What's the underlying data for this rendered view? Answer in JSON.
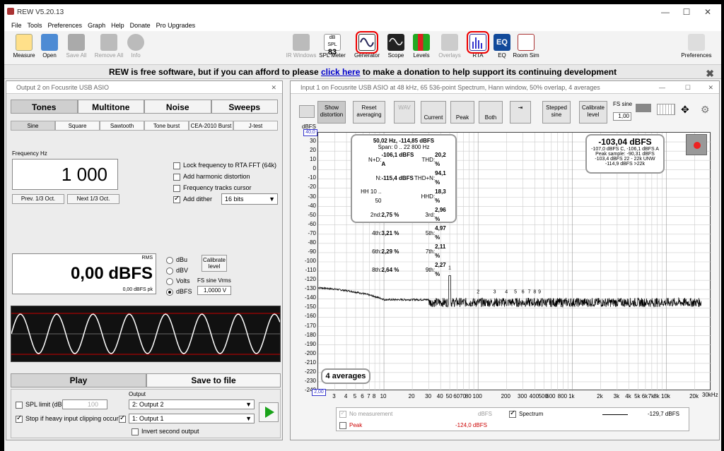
{
  "app": {
    "title": "REW V5.20.13"
  },
  "menu": [
    "File",
    "Tools",
    "Preferences",
    "Graph",
    "Help",
    "Donate",
    "Pro Upgrades"
  ],
  "toolbar": {
    "measure": "Measure",
    "open": "Open",
    "save_all": "Save All",
    "remove_all": "Remove All",
    "info": "Info",
    "ir_windows": "IR Windows",
    "spl_meter": "SPL Meter",
    "spl_badge": "dB SPL",
    "spl_value": "83",
    "generator": "Generator",
    "scope": "Scope",
    "levels": "Levels",
    "overlays": "Overlays",
    "rta": "RTA",
    "eq": "EQ",
    "room_sim": "Room Sim",
    "preferences": "Preferences"
  },
  "banner": {
    "text_before": "REW is free software, but if you can afford to please",
    "link": "click here",
    "text_after": "to make a donation to help support its continuing development",
    "close": "✖"
  },
  "generator": {
    "title": "Output 2 on Focusrite USB ASIO",
    "tabs": [
      "Tones",
      "Multitone",
      "Noise",
      "Sweeps"
    ],
    "subtabs": [
      "Sine",
      "Square",
      "Sawtooth",
      "Tone burst",
      "CEA-2010 Burst",
      "J-test"
    ],
    "freq_label": "Frequency Hz",
    "freq_value": "1 000",
    "prev": "Prev. 1/3 Oct.",
    "next": "Next 1/3 Oct.",
    "opt_lock": "Lock frequency to RTA FFT (64k)",
    "opt_harm": "Add harmonic distortion",
    "opt_cursor": "Frequency tracks cursor",
    "opt_dither": "Add dither",
    "dither_value": "16 bits",
    "rms_label": "RMS",
    "level_value": "0,00 dBFS",
    "level_pk": "0,00 dBFS pk",
    "units": [
      "dBu",
      "dBV",
      "Volts",
      "dBFS"
    ],
    "calibrate": "Calibrate level",
    "fs_sine": "FS sine Vrms",
    "fs_value": "1,0000 V",
    "play": "Play",
    "save": "Save to file",
    "spl_limit": "SPL limit (dB):",
    "spl_limit_val": "100",
    "stop_clip": "Stop if heavy input clipping occurs",
    "output_label": "Output",
    "output1": "2: Output 2",
    "output2": "1: Output 1",
    "invert": "Invert second output"
  },
  "rta": {
    "title": "Input 1 on Focusrite USB ASIO at 48 kHz, 65 536-point Spectrum, Hann window, 50% overlap, 4 averages",
    "buttons": {
      "show": "Show distortion",
      "reset": "Reset averaging",
      "wav": "WAV",
      "current": "Current",
      "peak": "Peak",
      "both": "Both",
      "stepped": "Stepped sine",
      "calibrate": "Calibrate level",
      "fs_sine": "FS sine",
      "fs_val": "1,00"
    },
    "ylabel": "dBFS",
    "ymax_label": "40,0",
    "xmin_label": "2,00",
    "xunit": "30kHz",
    "yticks": [
      "30",
      "20",
      "10",
      "0",
      "-10",
      "-20",
      "-30",
      "-40",
      "-50",
      "-60",
      "-70",
      "-80",
      "-90",
      "-100",
      "-110",
      "-120",
      "-130",
      "-140",
      "-150",
      "-160",
      "-170",
      "-180",
      "-190",
      "-200",
      "-210",
      "-220",
      "-230",
      "-240"
    ],
    "xticks": [
      "3",
      "4",
      "5",
      "6",
      "7",
      "8",
      "10",
      "20",
      "30",
      "40",
      "50",
      "60",
      "70",
      "80",
      "100",
      "200",
      "300",
      "400",
      "500",
      "600",
      "800",
      "1k",
      "2k",
      "3k",
      "4k",
      "5k",
      "6k",
      "7k",
      "8k",
      "10k",
      "20k"
    ],
    "harm_labels": [
      "1",
      "2",
      "3",
      "4",
      "5",
      "6",
      "7",
      "8",
      "9"
    ],
    "dist": {
      "fund": "50,02 Hz, -114,85 dBFS",
      "span": "Span: 0 .. 22 800 Hz",
      "rows": [
        [
          "N+D:",
          "-106,1 dBFS A",
          "THD:",
          "20,2 %"
        ],
        [
          "N:",
          "-115,4 dBFS",
          "THD+N:",
          "94,1 %"
        ],
        [
          "HH 10 .. 50",
          "",
          "HHD:",
          "18,3 %"
        ],
        [
          "2nd:",
          "2,75 %",
          "3rd:",
          "2,96 %"
        ],
        [
          "4th:",
          "3,21 %",
          "5th:",
          "4,97 %"
        ],
        [
          "6th:",
          "2,29 %",
          "7th:",
          "2,11 %"
        ],
        [
          "8th:",
          "2,64 %",
          "9th:",
          "2,27 %"
        ]
      ]
    },
    "level": {
      "main": "-103,04 dBFS",
      "l1": "-107,0 dBFS C, -106,1 dBFS A",
      "l2": "Peak sample: -90,31 dBFS",
      "l3": "-103,4 dBFS 22 - 22k UNW",
      "l4": "-114,9 dBFS >22k"
    },
    "averages": "4 averages",
    "legend": {
      "nomeas": "No measurement",
      "nomeas_unit": "dBFS",
      "spectrum": "Spectrum",
      "spectrum_val": "-129,7 dBFS",
      "peak": "Peak",
      "peak_val": "-124,0 dBFS"
    }
  },
  "colors": {
    "accent_red": "#e00000",
    "trace": "#000000",
    "peak_red": "#cc0000"
  }
}
